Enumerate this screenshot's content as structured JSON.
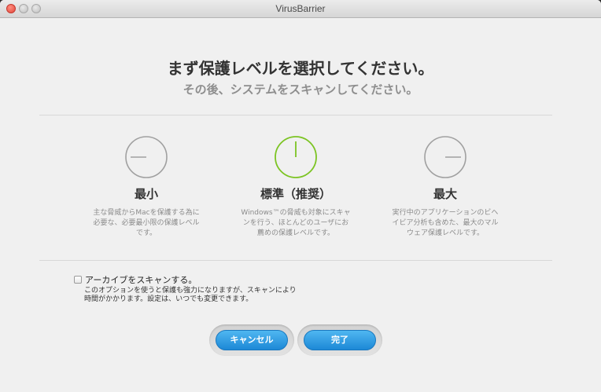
{
  "window": {
    "title": "VirusBarrier"
  },
  "header": {
    "title": "まず保護レベルを選択してください。",
    "subtitle": "その後、システムをスキャンしてください。"
  },
  "options": [
    {
      "title": "最小",
      "desc_lines": [
        "主な脅威からMacを保護する為に",
        "必要な、必要最小限の保護レベル",
        "です。"
      ],
      "gauge_color": "#9e9e9e",
      "selected": false
    },
    {
      "title": "標準（推奨）",
      "desc_lines": [
        "Windows™の脅威も対象にスキャ",
        "ンを行う、ほとんどのユーザにお",
        "薦めの保護レベルです。"
      ],
      "gauge_color": "#7cc423",
      "selected": true
    },
    {
      "title": "最大",
      "desc_lines": [
        "実行中のアプリケーションのビヘ",
        "イビア分析も含めた、最大のマル",
        "ウェア保護レベルです。"
      ],
      "gauge_color": "#9e9e9e",
      "selected": false
    }
  ],
  "archive": {
    "label": "アーカイブをスキャンする。",
    "checked": false,
    "desc_lines": [
      "このオプションを使うと保護も強力になりますが、スキャンにより",
      "時間がかかります。設定は、いつでも変更できます。"
    ]
  },
  "buttons": {
    "cancel": "キャンセル",
    "done": "完了"
  },
  "colors": {
    "accent": "#2a96e0",
    "selected": "#7cc423"
  }
}
